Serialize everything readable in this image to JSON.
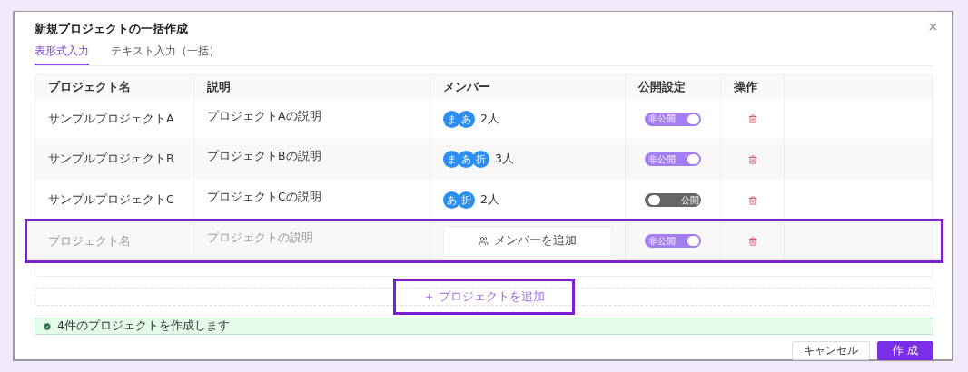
{
  "dialog": {
    "title": "新規プロジェクトの一括作成"
  },
  "tabs": [
    {
      "label": "表形式入力",
      "selected": true
    },
    {
      "label": "テキスト入力（一括）",
      "selected": false
    }
  ],
  "table": {
    "columns": [
      "プロジェクト名",
      "説明",
      "メンバー",
      "公開設定",
      "操作"
    ],
    "rows": [
      {
        "name": "サンプルプロジェクトA",
        "description": "プロジェクトAの説明",
        "avatars": [
          "ま",
          "あ"
        ],
        "member_count": "2人",
        "visibility": {
          "label": "非公開",
          "on": true
        },
        "shaded": false
      },
      {
        "name": "サンプルプロジェクトB",
        "description": "プロジェクトBの説明",
        "avatars": [
          "ま",
          "あ",
          "折"
        ],
        "member_count": "3人",
        "visibility": {
          "label": "非公開",
          "on": true
        },
        "shaded": true
      },
      {
        "name": "サンプルプロジェクトC",
        "description": "プロジェクトCの説明",
        "avatars": [
          "あ",
          "折"
        ],
        "member_count": "2人",
        "visibility": {
          "label": "公開",
          "on": false
        },
        "shaded": false
      }
    ],
    "new_row": {
      "name_placeholder": "プロジェクト名",
      "description_placeholder": "プロジェクトの説明",
      "add_member": "メンバーを追加",
      "visibility": {
        "label": "非公開",
        "on": true
      },
      "highlighted": true
    }
  },
  "add_project": {
    "label": "＋ プロジェクトを追加",
    "highlighted": true
  },
  "notice": "4件のプロジェクトを作成します",
  "buttons": [
    {
      "label": "キャンセル",
      "kind": "secondary"
    },
    {
      "label": "作 成",
      "kind": "primary"
    }
  ]
}
